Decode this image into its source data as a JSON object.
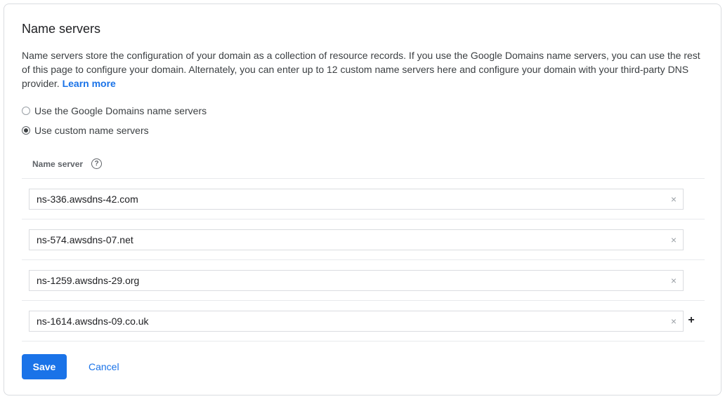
{
  "section": {
    "title": "Name servers",
    "description": "Name servers store the configuration of your domain as a collection of resource records. If you use the Google Domains name servers, you can use the rest of this page to configure your domain. Alternately, you can enter up to 12 custom name servers here and configure your domain with your third-party DNS provider.",
    "learn_more_label": "Learn more"
  },
  "options": {
    "google_label": "Use the Google Domains name servers",
    "custom_label": "Use custom name servers",
    "selected": "custom"
  },
  "table": {
    "header_label": "Name server",
    "help_icon": "?",
    "rows": [
      {
        "value": "ns-336.awsdns-42.com",
        "clear_icon": "×"
      },
      {
        "value": "ns-574.awsdns-07.net",
        "clear_icon": "×"
      },
      {
        "value": "ns-1259.awsdns-29.org",
        "clear_icon": "×"
      },
      {
        "value": "ns-1614.awsdns-09.co.uk",
        "clear_icon": "×"
      }
    ],
    "add_icon": "+"
  },
  "actions": {
    "save_label": "Save",
    "cancel_label": "Cancel"
  },
  "colors": {
    "accent": "#1a73e8",
    "border": "#dadce0",
    "divider": "#e8eaed"
  }
}
